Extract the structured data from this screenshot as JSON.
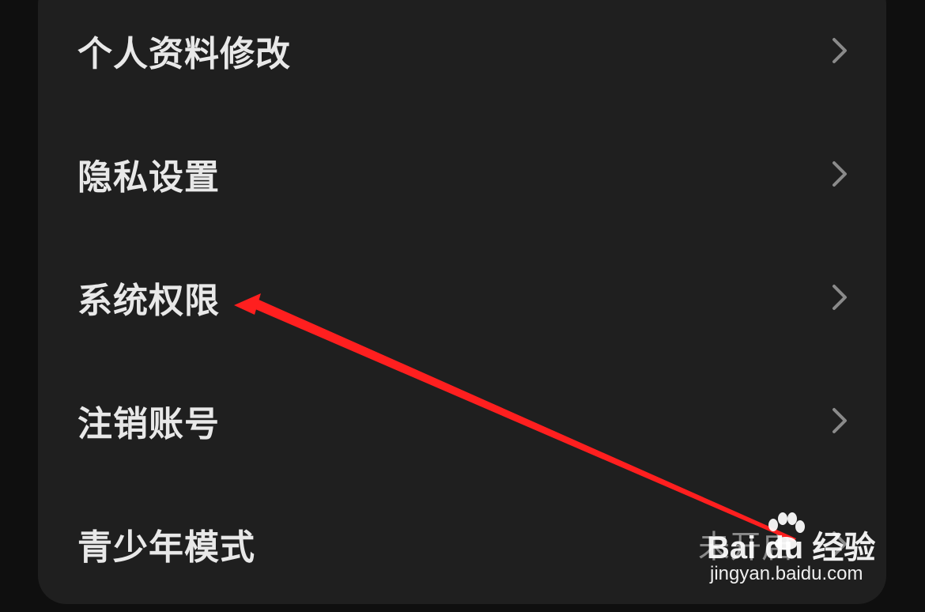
{
  "settings": {
    "items": [
      {
        "label": "个人资料修改",
        "status": "",
        "icon": "chevron-right-icon"
      },
      {
        "label": "隐私设置",
        "status": "",
        "icon": "chevron-right-icon"
      },
      {
        "label": "系统权限",
        "status": "",
        "icon": "chevron-right-icon"
      },
      {
        "label": "注销账号",
        "status": "",
        "icon": "chevron-right-icon"
      },
      {
        "label": "青少年模式",
        "status": "未开启",
        "icon": "chevron-right-icon"
      }
    ]
  },
  "annotation": {
    "type": "arrow",
    "color": "#ff1f1f",
    "points_to": "系统权限"
  },
  "watermark": {
    "brand": "Bai du 经验",
    "url": "jingyan.baidu.com"
  },
  "colors": {
    "background": "#0f0f0f",
    "card": "#1f1f1f",
    "text": "#e8e8e8",
    "chevron": "#8a8a8a",
    "arrow": "#ff1f1f"
  }
}
